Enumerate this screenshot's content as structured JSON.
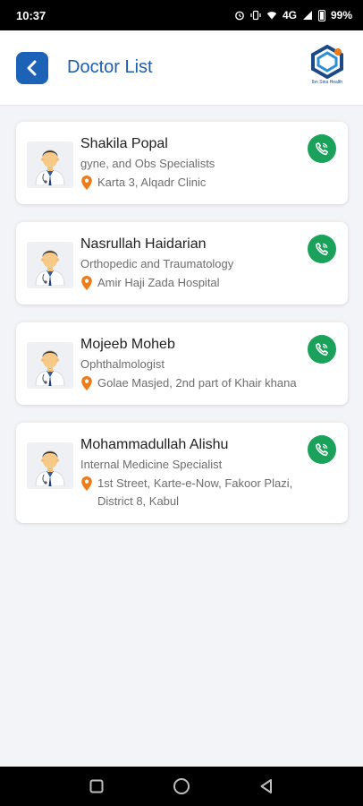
{
  "status_bar": {
    "time": "10:37",
    "network": "4G",
    "battery": "99%"
  },
  "header": {
    "title": "Doctor List",
    "logo_caption": "Ibn Sina Health",
    "back_icon": "chevron-left-icon"
  },
  "doctors": [
    {
      "name": "Shakila Popal",
      "specialty": "gyne, and Obs Specialists",
      "address": "Karta 3, Alqadr Clinic"
    },
    {
      "name": "Nasrullah Haidarian",
      "specialty": "Orthopedic and Traumatology",
      "address": "Amir Haji Zada Hospital"
    },
    {
      "name": "Mojeeb Moheb",
      "specialty": "Ophthalmologist",
      "address": "Golae Masjed, 2nd part of Khair khana"
    },
    {
      "name": "Mohammadullah Alishu",
      "specialty": "Internal Medicine Specialist",
      "address": "1st Street, Karte-e-Now, Fakoor Plazi, District 8, Kabul"
    }
  ],
  "colors": {
    "brand_blue": "#1c63b7",
    "call_green": "#1aa15a",
    "pin_orange": "#f07a1a"
  }
}
